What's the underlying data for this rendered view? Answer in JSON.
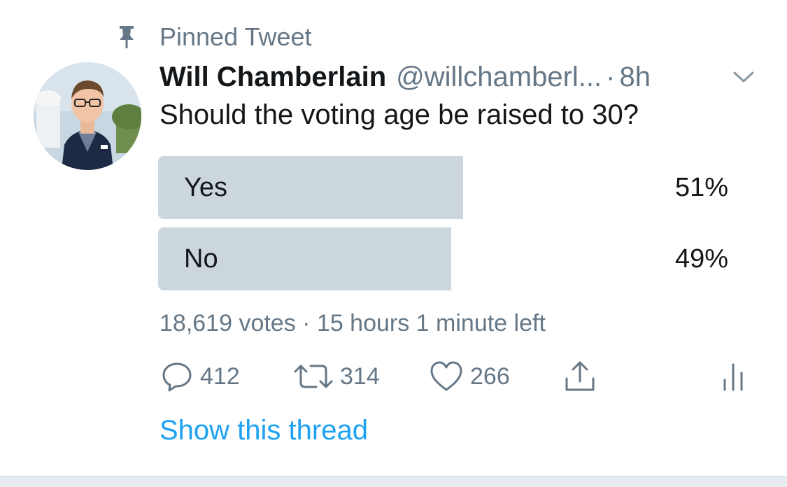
{
  "pinned": {
    "label": "Pinned Tweet",
    "icon": "pin-icon"
  },
  "author": {
    "name": "Will Chamberlain",
    "handle": "@willchamberl...",
    "separator": "·",
    "time": "8h"
  },
  "tweet": {
    "text": "Should the voting age be raised to 30?"
  },
  "poll": {
    "options": [
      {
        "label": "Yes",
        "percent_text": "51%",
        "percent": 51
      },
      {
        "label": "No",
        "percent_text": "49%",
        "percent": 49
      }
    ],
    "meta": "18,619 votes · 15 hours 1 minute left"
  },
  "actions": {
    "reply": {
      "icon": "reply-icon",
      "count": "412"
    },
    "retweet": {
      "icon": "retweet-icon",
      "count": "314"
    },
    "like": {
      "icon": "heart-icon",
      "count": "266"
    },
    "share": {
      "icon": "share-icon"
    },
    "analytics": {
      "icon": "analytics-icon"
    }
  },
  "show_thread": "Show this thread",
  "colors": {
    "secondary_text": "#657786",
    "poll_bar": "#ccd6dd",
    "link": "#1da1f2",
    "primary_text": "#14171a"
  }
}
